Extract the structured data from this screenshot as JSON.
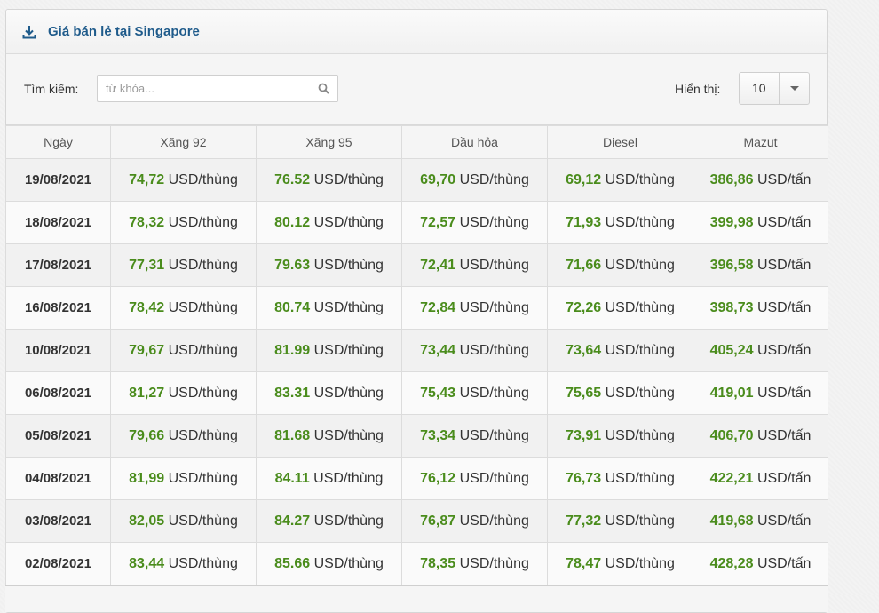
{
  "panel": {
    "title": "Giá bán lẻ tại Singapore",
    "icon": "download-icon"
  },
  "search": {
    "label": "Tìm kiếm:",
    "placeholder": "từ khóa...",
    "value": "",
    "icon": "search-icon"
  },
  "page_size": {
    "label": "Hiển thị:",
    "selected": "10"
  },
  "table": {
    "headers": [
      "Ngày",
      "Xăng 92",
      "Xăng 95",
      "Dầu hỏa",
      "Diesel",
      "Mazut"
    ],
    "rows": [
      {
        "date": "19/08/2021",
        "cells": [
          {
            "num": "74,72",
            "unit": " USD/thùng"
          },
          {
            "num": "76.52",
            "unit": " USD/thùng"
          },
          {
            "num": "69,70",
            "unit": " USD/thùng"
          },
          {
            "num": "69,12",
            "unit": " USD/thùng"
          },
          {
            "num": "386,86",
            "unit": " USD/tấn"
          }
        ]
      },
      {
        "date": "18/08/2021",
        "cells": [
          {
            "num": "78,32",
            "unit": " USD/thùng"
          },
          {
            "num": "80.12",
            "unit": " USD/thùng"
          },
          {
            "num": "72,57",
            "unit": " USD/thùng"
          },
          {
            "num": "71,93",
            "unit": " USD/thùng"
          },
          {
            "num": "399,98",
            "unit": " USD/tấn"
          }
        ]
      },
      {
        "date": "17/08/2021",
        "cells": [
          {
            "num": "77,31",
            "unit": " USD/thùng"
          },
          {
            "num": "79.63",
            "unit": " USD/thùng"
          },
          {
            "num": "72,41",
            "unit": " USD/thùng"
          },
          {
            "num": "71,66",
            "unit": " USD/thùng"
          },
          {
            "num": "396,58",
            "unit": " USD/tấn"
          }
        ]
      },
      {
        "date": "16/08/2021",
        "cells": [
          {
            "num": "78,42",
            "unit": " USD/thùng"
          },
          {
            "num": "80.74",
            "unit": " USD/thùng"
          },
          {
            "num": "72,84",
            "unit": " USD/thùng"
          },
          {
            "num": "72,26",
            "unit": " USD/thùng"
          },
          {
            "num": "398,73",
            "unit": " USD/tấn"
          }
        ]
      },
      {
        "date": "10/08/2021",
        "cells": [
          {
            "num": "79,67",
            "unit": " USD/thùng"
          },
          {
            "num": "81.99",
            "unit": " USD/thùng"
          },
          {
            "num": "73,44",
            "unit": " USD/thùng"
          },
          {
            "num": "73,64",
            "unit": " USD/thùng"
          },
          {
            "num": "405,24",
            "unit": " USD/tấn"
          }
        ]
      },
      {
        "date": "06/08/2021",
        "cells": [
          {
            "num": "81,27",
            "unit": " USD/thùng"
          },
          {
            "num": "83.31",
            "unit": " USD/thùng"
          },
          {
            "num": "75,43",
            "unit": " USD/thùng"
          },
          {
            "num": "75,65",
            "unit": " USD/thùng"
          },
          {
            "num": "419,01",
            "unit": " USD/tấn"
          }
        ]
      },
      {
        "date": "05/08/2021",
        "cells": [
          {
            "num": "79,66",
            "unit": " USD/thùng"
          },
          {
            "num": "81.68",
            "unit": " USD/thùng"
          },
          {
            "num": "73,34",
            "unit": " USD/thùng"
          },
          {
            "num": "73,91",
            "unit": " USD/thùng"
          },
          {
            "num": "406,70",
            "unit": " USD/tấn"
          }
        ]
      },
      {
        "date": "04/08/2021",
        "cells": [
          {
            "num": "81,99",
            "unit": " USD/thùng"
          },
          {
            "num": "84.11",
            "unit": " USD/thùng"
          },
          {
            "num": "76,12",
            "unit": " USD/thùng"
          },
          {
            "num": "76,73",
            "unit": " USD/thùng"
          },
          {
            "num": "422,21",
            "unit": " USD/tấn"
          }
        ]
      },
      {
        "date": "03/08/2021",
        "cells": [
          {
            "num": "82,05",
            "unit": " USD/thùng"
          },
          {
            "num": "84.27",
            "unit": " USD/thùng"
          },
          {
            "num": "76,87",
            "unit": " USD/thùng"
          },
          {
            "num": "77,32",
            "unit": " USD/thùng"
          },
          {
            "num": "419,68",
            "unit": " USD/tấn"
          }
        ]
      },
      {
        "date": "02/08/2021",
        "cells": [
          {
            "num": "83,44",
            "unit": " USD/thùng"
          },
          {
            "num": "85.66",
            "unit": " USD/thùng"
          },
          {
            "num": "78,35",
            "unit": " USD/thùng"
          },
          {
            "num": "78,47",
            "unit": " USD/thùng"
          },
          {
            "num": "428,28",
            "unit": " USD/tấn"
          }
        ]
      }
    ]
  },
  "colors": {
    "title": "#1f5b8b",
    "value": "#4a8c1c",
    "border": "#dcdcdc"
  }
}
